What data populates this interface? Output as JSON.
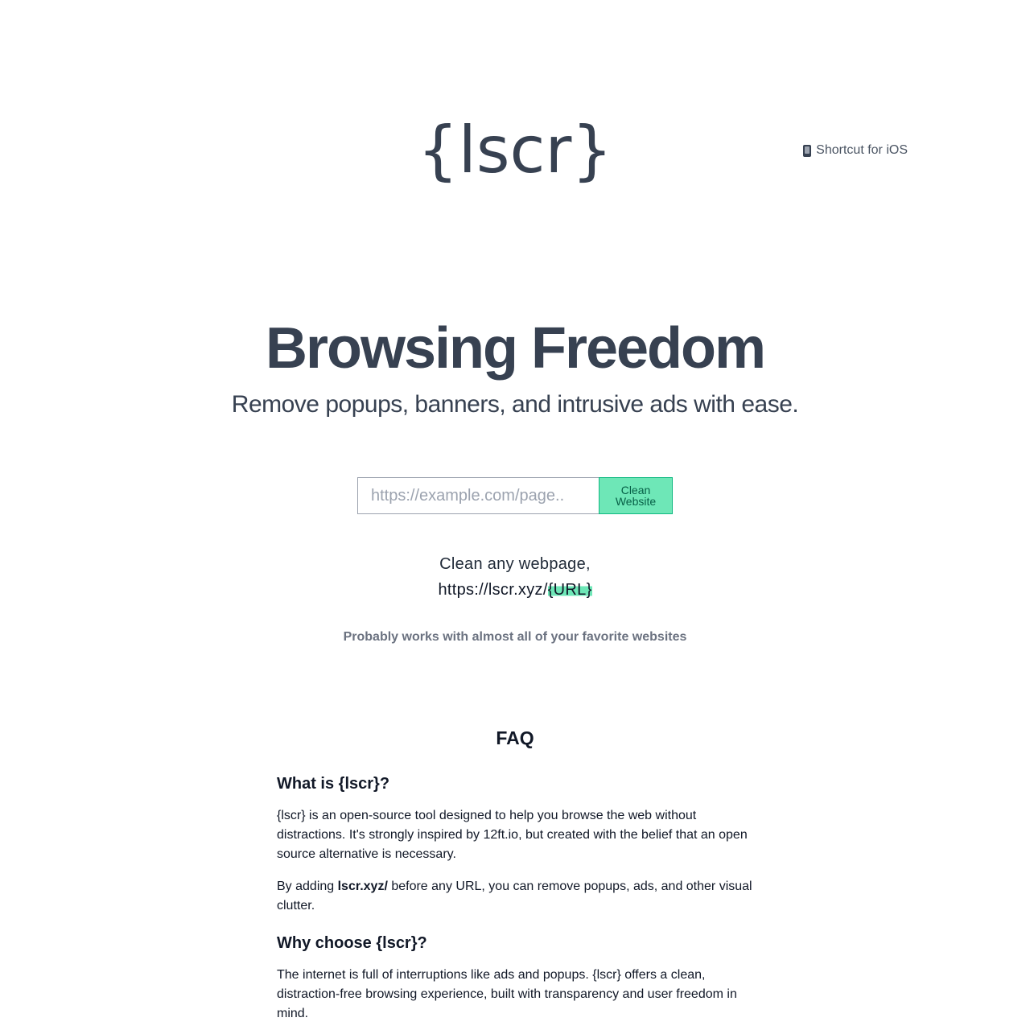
{
  "header": {
    "logo_text": "{lscr}",
    "ios_link_label": "Shortcut for iOS",
    "ios_link_icon": "phone-icon"
  },
  "hero": {
    "title": "Browsing Freedom",
    "subtitle": "Remove popups, banners, and intrusive ads with ease."
  },
  "form": {
    "url_placeholder": "https://example.com/page..",
    "url_value": "",
    "submit_label": "Clean Website"
  },
  "usage": {
    "line1": "Clean any webpage,",
    "url_prefix": "https://lscr.xyz/",
    "url_token": "{URL}",
    "highlight_color": "#6ee7b7"
  },
  "note": "Probably works with almost all of your favorite websites",
  "faq": {
    "title": "FAQ",
    "q1": {
      "question": "What is {lscr}?",
      "answer1": "{lscr} is an open-source tool designed to help you browse the web without distractions. It's strongly inspired by 12ft.io, but created with the belief that an open source alternative is necessary.",
      "answer2_prefix": "By adding ",
      "answer2_bold": "lscr.xyz/",
      "answer2_suffix": " before any URL, you can remove popups, ads, and other visual clutter."
    },
    "q2": {
      "question": "Why choose {lscr}?",
      "answer1": "The internet is full of interruptions like ads and popups. {lscr} offers a clean, distraction-free browsing experience, built with transparency and user freedom in mind."
    }
  },
  "colors": {
    "text_dark": "#374151",
    "accent_green": "#6ee7b7",
    "accent_green_border": "#10b981",
    "muted": "#6b7280"
  }
}
